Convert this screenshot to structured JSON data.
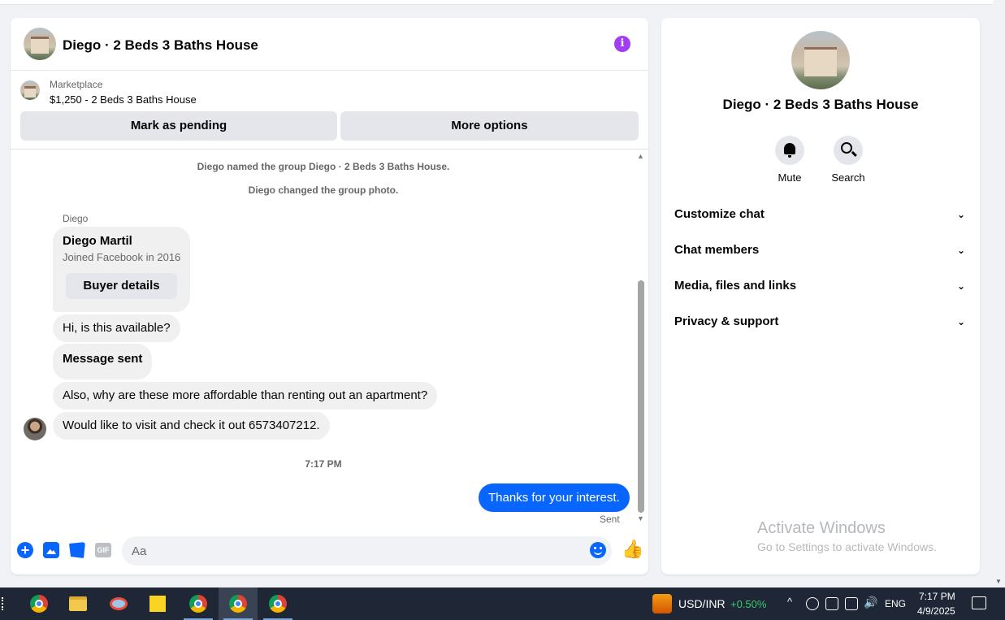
{
  "chat": {
    "title": "Diego · 2 Beds 3 Baths House",
    "info_icon": "i",
    "listing": {
      "source": "Marketplace",
      "title": "$1,250 - 2 Beds 3 Baths House"
    },
    "buttons": {
      "pending": "Mark as pending",
      "more": "More options"
    },
    "system_messages": [
      "Diego named the group Diego · 2 Beds 3 Baths House.",
      "Diego changed the group photo."
    ],
    "sender_name": "Diego",
    "profile_card": {
      "name": "Diego Martil",
      "subtitle": "Joined Facebook in 2016",
      "button": "Buyer details"
    },
    "incoming_messages": [
      "Hi, is this available?",
      "Message sent",
      "Also, why are these more affordable than renting out an apartment?",
      "Would like to visit and check it out 6573407212."
    ],
    "timestamp": "7:17 PM",
    "outgoing_message": "Thanks for your interest.",
    "delivery_status": "Sent",
    "composer": {
      "placeholder": "Aa",
      "gif_label": "GIF",
      "plus_glyph": "+",
      "like_glyph": "👍"
    }
  },
  "info_panel": {
    "title": "Diego · 2 Beds 3 Baths House",
    "actions": [
      {
        "label": "Mute",
        "icon": "bell-icon"
      },
      {
        "label": "Search",
        "icon": "search-icon"
      }
    ],
    "sections": [
      "Customize chat",
      "Chat members",
      "Media, files and links",
      "Privacy & support"
    ],
    "chevron": "⌄",
    "watermark_title": "Activate Windows",
    "watermark_sub": "Go to Settings to activate Windows."
  },
  "taskbar": {
    "apps": [
      "chrome-icon",
      "file-explorer-icon",
      "snipping-tool-icon",
      "sticky-notes-icon",
      "chrome-icon",
      "chrome-icon",
      "chrome-icon"
    ],
    "ticker_name": "USD/INR",
    "ticker_change": "+0.50%",
    "tray_caret": "^",
    "volume_glyph": "🔊",
    "language": "ENG",
    "clock_time": "7:17 PM",
    "clock_date": "4/9/2025"
  },
  "colors": {
    "accent": "#0866ff",
    "info_icon": "#a33cf5",
    "taskbar": "#1f2736",
    "ticker_up": "#37c86d"
  }
}
